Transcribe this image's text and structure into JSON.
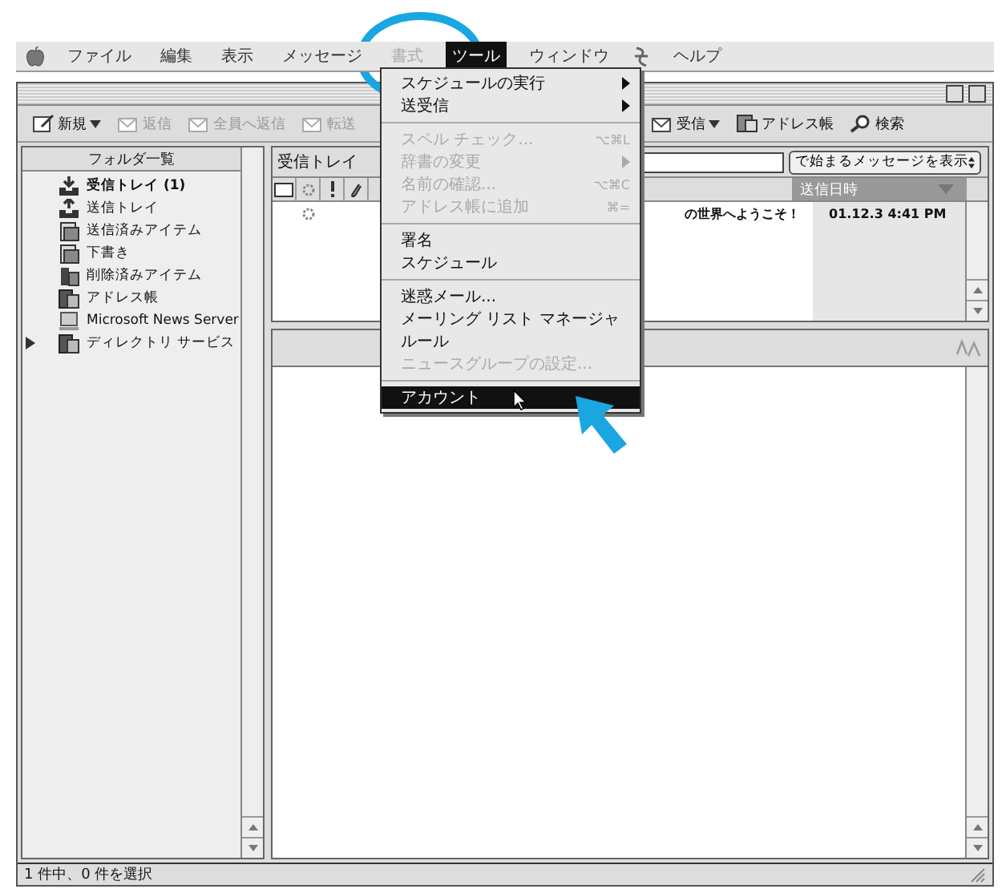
{
  "menu_bar": {
    "items": [
      {
        "label": "ファイル",
        "disabled": false,
        "selected": false
      },
      {
        "label": "編集",
        "disabled": false,
        "selected": false
      },
      {
        "label": "表示",
        "disabled": false,
        "selected": false
      },
      {
        "label": "メッセージ",
        "disabled": false,
        "selected": false
      },
      {
        "label": "書式",
        "disabled": true,
        "selected": false
      },
      {
        "label": "ツール",
        "disabled": false,
        "selected": true
      },
      {
        "label": "ウィンドウ",
        "disabled": false,
        "selected": false
      },
      {
        "label": "ヘルプ",
        "disabled": false,
        "selected": false
      }
    ]
  },
  "toolbar": {
    "buttons": [
      {
        "kind": "new",
        "label": "新規",
        "disabled": false,
        "dropdown": true
      },
      {
        "kind": "reply",
        "label": "返信",
        "disabled": true,
        "dropdown": false
      },
      {
        "kind": "reply_all",
        "label": "全員へ返信",
        "disabled": true,
        "dropdown": false
      },
      {
        "kind": "forward",
        "label": "転送",
        "disabled": true,
        "dropdown": false
      },
      {
        "kind": "send_receive",
        "label": "受信",
        "disabled": false,
        "dropdown": true
      },
      {
        "kind": "address_book",
        "label": "アドレス帳",
        "disabled": false,
        "dropdown": false
      },
      {
        "kind": "find",
        "label": "検索",
        "disabled": false,
        "dropdown": false
      }
    ]
  },
  "folder_pane": {
    "header": "フォルダ一覧",
    "folders": [
      {
        "kind": "inbox",
        "label": "受信トレイ (1)",
        "bold": true,
        "expandable": false
      },
      {
        "kind": "outbox",
        "label": "送信トレイ",
        "bold": false,
        "expandable": false
      },
      {
        "kind": "sent",
        "label": "送信済みアイテム",
        "bold": false,
        "expandable": false
      },
      {
        "kind": "drafts",
        "label": "下書き",
        "bold": false,
        "expandable": false
      },
      {
        "kind": "deleted",
        "label": "削除済みアイテム",
        "bold": false,
        "expandable": false
      },
      {
        "kind": "address_book",
        "label": "アドレス帳",
        "bold": false,
        "expandable": false
      },
      {
        "kind": "news",
        "label": "Microsoft News Server",
        "bold": false,
        "expandable": false
      },
      {
        "kind": "directory",
        "label": "ディレクトリ サービス",
        "bold": false,
        "expandable": true
      }
    ]
  },
  "message_list": {
    "title": "受信トレイ",
    "filter_menu": "で始まるメッセージを表示",
    "date_column": "送信日時",
    "rows": [
      {
        "subject": "の世界へようこそ！",
        "date": "01.12.3 4:41 PM"
      }
    ]
  },
  "tools_menu": {
    "groups": [
      [
        {
          "label": "スケジュールの実行",
          "submenu": true,
          "disabled": false,
          "selected": false
        },
        {
          "label": "送受信",
          "submenu": true,
          "disabled": false,
          "selected": false
        }
      ],
      [
        {
          "label": "スペル チェック...",
          "shortcut": "⌥⌘L",
          "submenu": false,
          "disabled": true,
          "selected": false
        },
        {
          "label": "辞書の変更",
          "submenu": true,
          "disabled": true,
          "selected": false
        },
        {
          "label": "名前の確認...",
          "shortcut": "⌥⌘C",
          "submenu": false,
          "disabled": true,
          "selected": false
        },
        {
          "label": "アドレス帳に追加",
          "shortcut": "⌘=",
          "submenu": false,
          "disabled": true,
          "selected": false
        }
      ],
      [
        {
          "label": "署名",
          "submenu": false,
          "disabled": false,
          "selected": false
        },
        {
          "label": "スケジュール",
          "submenu": false,
          "disabled": false,
          "selected": false
        }
      ],
      [
        {
          "label": "迷惑メール...",
          "submenu": false,
          "disabled": false,
          "selected": false
        },
        {
          "label": "メーリング リスト マネージャ",
          "submenu": false,
          "disabled": false,
          "selected": false
        },
        {
          "label": "ルール",
          "submenu": false,
          "disabled": false,
          "selected": false
        },
        {
          "label": "ニュースグループの設定...",
          "submenu": false,
          "disabled": true,
          "selected": false
        }
      ],
      [
        {
          "label": "アカウント",
          "submenu": false,
          "disabled": false,
          "selected": true
        }
      ]
    ]
  },
  "status_bar": "1 件中、0 件を選択"
}
